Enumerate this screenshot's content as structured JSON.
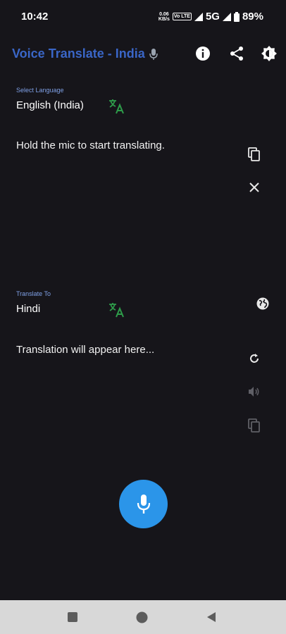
{
  "status_bar": {
    "time": "10:42",
    "net_speed_top": "0.06",
    "net_speed_bottom": "KB/s",
    "volte": "Vo LTE",
    "network": "5G",
    "battery": "89%"
  },
  "app_bar": {
    "title": "Voice Translate - India",
    "title_icon": "microphone-emoji",
    "actions": [
      "info-icon",
      "share-icon",
      "brightness-icon"
    ]
  },
  "source": {
    "label": "Select Language",
    "language": "English (India)",
    "text": "Hold the mic to start translating.",
    "actions": [
      "copy-icon",
      "close-icon"
    ]
  },
  "target": {
    "label": "Translate To",
    "language": "Hindi",
    "text": "Translation will appear here...",
    "actions": [
      "globe-icon",
      "refresh-icon",
      "speaker-icon",
      "copy-icon"
    ]
  },
  "colors": {
    "background": "#16151a",
    "title": "#3a66c7",
    "label": "#7fa0e6",
    "translate_icon": "#2e9c4a",
    "fab": "#2b95e9"
  }
}
